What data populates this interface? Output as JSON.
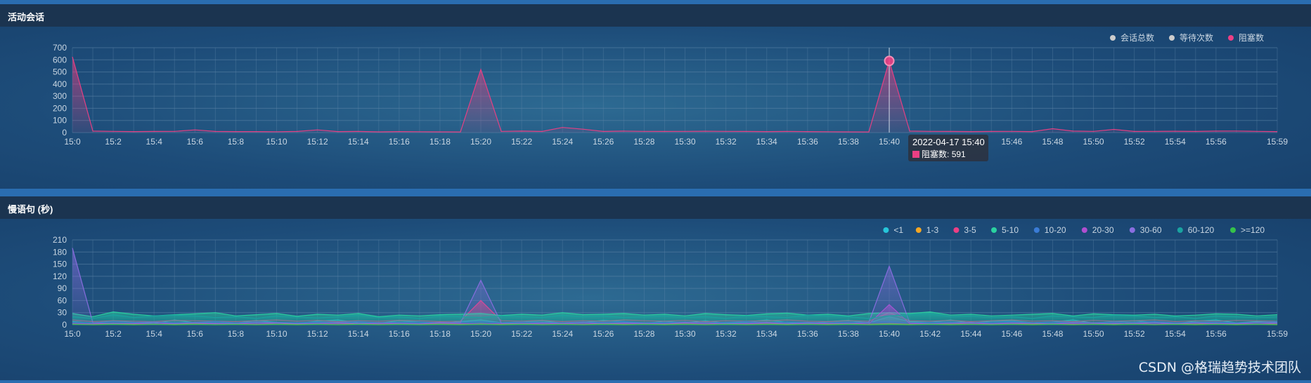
{
  "panels": [
    {
      "id": "p1",
      "title": "活动会话"
    },
    {
      "id": "p2",
      "title": "慢语句 (秒)"
    }
  ],
  "watermark": "CSDN @格瑞趋势技术团队",
  "colors": {
    "bg_dark": "#1b3450",
    "grid": "#5f86aa",
    "tick": "#c9d6e2",
    "total": "#cccccc",
    "wait": "#cccccc",
    "block": "#ec3f84"
  },
  "chart_data": [
    {
      "type": "area",
      "title": "活动会话",
      "x": [
        "15:0",
        "15:1",
        "15:2",
        "15:3",
        "15:4",
        "15:5",
        "15:6",
        "15:7",
        "15:8",
        "15:9",
        "15:10",
        "15:11",
        "15:12",
        "15:13",
        "15:14",
        "15:15",
        "15:16",
        "15:17",
        "15:18",
        "15:19",
        "15:20",
        "15:21",
        "15:22",
        "15:23",
        "15:24",
        "15:25",
        "15:26",
        "15:27",
        "15:28",
        "15:29",
        "15:30",
        "15:31",
        "15:32",
        "15:33",
        "15:34",
        "15:35",
        "15:36",
        "15:37",
        "15:38",
        "15:39",
        "15:40",
        "15:41",
        "15:42",
        "15:43",
        "15:44",
        "15:45",
        "15:46",
        "15:47",
        "15:48",
        "15:49",
        "15:50",
        "15:51",
        "15:52",
        "15:53",
        "15:54",
        "15:55",
        "15:56",
        "15:57",
        "15:58",
        "15:59"
      ],
      "xticks": [
        "15:0",
        "15:2",
        "15:4",
        "15:6",
        "15:8",
        "15:10",
        "15:12",
        "15:14",
        "15:16",
        "15:18",
        "15:20",
        "15:22",
        "15:24",
        "15:26",
        "15:28",
        "15:30",
        "15:32",
        "15:34",
        "15:36",
        "15:38",
        "15:40",
        "15:42",
        "15:44",
        "15:46",
        "15:48",
        "15:50",
        "15:52",
        "15:54",
        "15:56",
        "15:59"
      ],
      "ylim": [
        0,
        700
      ],
      "yticks": [
        0,
        100,
        200,
        300,
        400,
        500,
        600,
        700
      ],
      "legend": [
        "会话总数",
        "等待次数",
        "阻塞数"
      ],
      "legend_position": "top-right",
      "grid": true,
      "series": [
        {
          "name": "阻塞数",
          "color": "#ec3f84",
          "values": [
            625,
            12,
            10,
            8,
            9,
            10,
            22,
            9,
            8,
            8,
            7,
            9,
            22,
            8,
            9,
            6,
            8,
            7,
            6,
            5,
            520,
            10,
            12,
            9,
            42,
            28,
            9,
            12,
            10,
            9,
            10,
            11,
            10,
            9,
            8,
            9,
            8,
            7,
            6,
            5,
            591,
            12,
            10,
            9,
            8,
            9,
            10,
            8,
            32,
            12,
            10,
            26,
            9,
            10,
            11,
            9,
            12,
            13,
            10,
            8
          ]
        }
      ],
      "tooltip": {
        "x_index": 40,
        "time": "2022-04-17 15:40",
        "label": "阻塞数: 591"
      }
    },
    {
      "type": "area",
      "title": "慢语句 (秒)",
      "x": [
        "15:0",
        "15:1",
        "15:2",
        "15:3",
        "15:4",
        "15:5",
        "15:6",
        "15:7",
        "15:8",
        "15:9",
        "15:10",
        "15:11",
        "15:12",
        "15:13",
        "15:14",
        "15:15",
        "15:16",
        "15:17",
        "15:18",
        "15:19",
        "15:20",
        "15:21",
        "15:22",
        "15:23",
        "15:24",
        "15:25",
        "15:26",
        "15:27",
        "15:28",
        "15:29",
        "15:30",
        "15:31",
        "15:32",
        "15:33",
        "15:34",
        "15:35",
        "15:36",
        "15:37",
        "15:38",
        "15:39",
        "15:40",
        "15:41",
        "15:42",
        "15:43",
        "15:44",
        "15:45",
        "15:46",
        "15:47",
        "15:48",
        "15:49",
        "15:50",
        "15:51",
        "15:52",
        "15:53",
        "15:54",
        "15:55",
        "15:56",
        "15:57",
        "15:58",
        "15:59"
      ],
      "xticks": [
        "15:0",
        "15:2",
        "15:4",
        "15:6",
        "15:8",
        "15:10",
        "15:12",
        "15:14",
        "15:16",
        "15:18",
        "15:20",
        "15:22",
        "15:24",
        "15:26",
        "15:28",
        "15:30",
        "15:32",
        "15:34",
        "15:36",
        "15:38",
        "15:40",
        "15:42",
        "15:44",
        "15:46",
        "15:48",
        "15:50",
        "15:52",
        "15:54",
        "15:56",
        "15:59"
      ],
      "ylim": [
        0,
        210
      ],
      "yticks": [
        0,
        30,
        60,
        90,
        120,
        150,
        180,
        210
      ],
      "legend_position": "top-right",
      "grid": true,
      "series": [
        {
          "name": "<1",
          "color": "#26c6da",
          "values": [
            8,
            4,
            10,
            6,
            3,
            12,
            5,
            8,
            4,
            11,
            6,
            3,
            9,
            12,
            5,
            4,
            10,
            7,
            3,
            8,
            12,
            5,
            7,
            10,
            4,
            6,
            11,
            8,
            3,
            9,
            5,
            10,
            4,
            7,
            12,
            6,
            3,
            8,
            11,
            5,
            20,
            8,
            6,
            12,
            4,
            9,
            10,
            5,
            7,
            12,
            4,
            8,
            10,
            6,
            3,
            9,
            12,
            5,
            8,
            6
          ]
        },
        {
          "name": "1-3",
          "color": "#f5a623",
          "values": [
            2,
            1,
            3,
            1,
            2,
            1,
            2,
            3,
            1,
            2,
            1,
            2,
            1,
            3,
            1,
            2,
            1,
            1,
            2,
            1,
            3,
            1,
            2,
            1,
            2,
            1,
            3,
            1,
            2,
            1,
            2,
            1,
            3,
            1,
            2,
            1,
            2,
            1,
            2,
            1,
            3,
            1,
            2,
            1,
            2,
            1,
            2,
            1,
            3,
            1,
            2,
            1,
            6,
            1,
            2,
            1,
            3,
            1,
            2,
            1
          ]
        },
        {
          "name": "3-5",
          "color": "#ec3f84",
          "values": [
            12,
            8,
            10,
            9,
            8,
            11,
            10,
            9,
            8,
            10,
            12,
            9,
            11,
            8,
            10,
            9,
            11,
            10,
            8,
            9,
            60,
            10,
            9,
            11,
            8,
            10,
            9,
            12,
            10,
            9,
            11,
            8,
            10,
            9,
            10,
            12,
            9,
            8,
            10,
            9,
            30,
            10,
            9,
            11,
            8,
            10,
            12,
            9,
            10,
            8,
            11,
            9,
            10,
            12,
            8,
            10,
            9,
            11,
            10,
            9
          ]
        },
        {
          "name": "5-10",
          "color": "#2ad2a0",
          "values": [
            28,
            20,
            32,
            26,
            22,
            25,
            27,
            30,
            22,
            25,
            28,
            21,
            26,
            24,
            28,
            20,
            24,
            22,
            25,
            26,
            28,
            23,
            26,
            24,
            30,
            25,
            26,
            28,
            24,
            26,
            22,
            28,
            25,
            23,
            27,
            29,
            24,
            26,
            22,
            28,
            30,
            28,
            32,
            24,
            26,
            22,
            24,
            26,
            28,
            22,
            27,
            25,
            24,
            26,
            22,
            24,
            27,
            26,
            22,
            25
          ]
        },
        {
          "name": "10-20",
          "color": "#3a7bd5",
          "values": [
            6,
            5,
            8,
            6,
            7,
            5,
            6,
            8,
            5,
            7,
            6,
            5,
            7,
            6,
            8,
            5,
            6,
            7,
            5,
            6,
            8,
            5,
            7,
            6,
            5,
            7,
            6,
            8,
            5,
            6,
            7,
            5,
            6,
            8,
            5,
            7,
            6,
            5,
            7,
            6,
            8,
            5,
            6,
            7,
            5,
            6,
            8,
            5,
            7,
            6,
            5,
            7,
            6,
            8,
            5,
            6,
            7,
            5,
            6,
            8
          ]
        },
        {
          "name": "20-30",
          "color": "#b04fd0",
          "values": [
            3,
            2,
            4,
            3,
            2,
            3,
            4,
            2,
            3,
            2,
            4,
            3,
            2,
            3,
            4,
            2,
            3,
            2,
            4,
            3,
            2,
            3,
            4,
            2,
            3,
            2,
            4,
            3,
            2,
            3,
            4,
            2,
            3,
            2,
            4,
            3,
            2,
            3,
            4,
            2,
            50,
            3,
            2,
            4,
            3,
            2,
            3,
            4,
            2,
            3,
            2,
            4,
            3,
            2,
            3,
            4,
            2,
            3,
            2,
            4
          ]
        },
        {
          "name": "30-60",
          "color": "#8a6ee0",
          "values": [
            190,
            5,
            3,
            4,
            6,
            3,
            5,
            4,
            3,
            6,
            5,
            3,
            4,
            6,
            3,
            5,
            4,
            3,
            6,
            5,
            110,
            4,
            3,
            5,
            4,
            6,
            3,
            5,
            4,
            3,
            6,
            5,
            3,
            4,
            6,
            3,
            5,
            4,
            3,
            6,
            145,
            5,
            3,
            4,
            6,
            3,
            5,
            4,
            3,
            6,
            5,
            3,
            4,
            6,
            3,
            5,
            4,
            3,
            6,
            5
          ]
        },
        {
          "name": "60-120",
          "color": "#1aa3a0",
          "values": [
            20,
            16,
            25,
            18,
            22,
            24,
            22,
            18,
            20,
            16,
            22,
            19,
            17,
            20,
            24,
            18,
            20,
            16,
            22,
            20,
            18,
            22,
            20,
            18,
            24,
            20,
            22,
            18,
            20,
            22,
            18,
            20,
            16,
            22,
            20,
            18,
            24,
            22,
            20,
            16,
            22,
            25,
            28,
            20,
            22,
            18,
            20,
            16,
            22,
            20,
            18,
            24,
            22,
            18,
            20,
            16,
            22,
            20,
            18,
            20
          ]
        },
        {
          "name": ">=120",
          "color": "#35c24a",
          "values": [
            1,
            0,
            1,
            0,
            1,
            0,
            1,
            0,
            1,
            0,
            1,
            0,
            1,
            0,
            1,
            0,
            1,
            0,
            1,
            0,
            1,
            0,
            1,
            0,
            1,
            0,
            1,
            0,
            1,
            0,
            1,
            0,
            1,
            0,
            1,
            0,
            1,
            0,
            1,
            0,
            1,
            0,
            1,
            0,
            1,
            0,
            1,
            0,
            1,
            0,
            1,
            0,
            1,
            0,
            1,
            0,
            1,
            0,
            1,
            0
          ]
        }
      ]
    }
  ]
}
